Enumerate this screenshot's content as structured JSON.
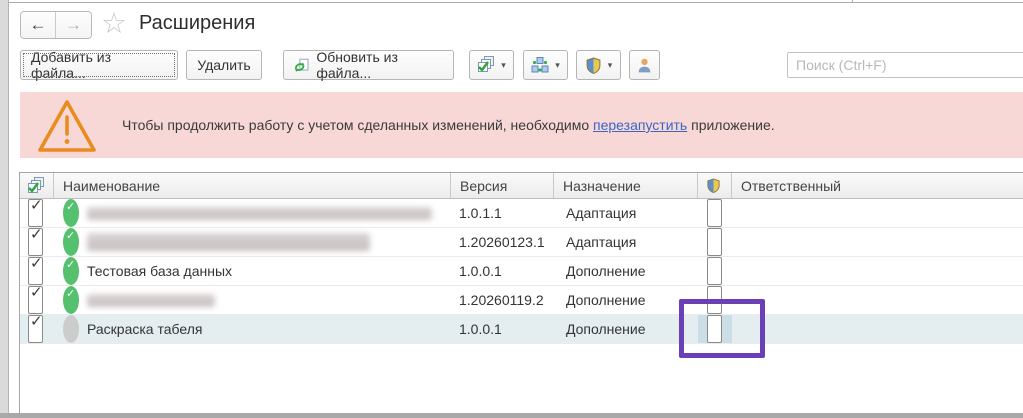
{
  "page": {
    "title": "Расширения"
  },
  "glyphs": {
    "back": "←",
    "forward": "→",
    "favorite_star": "☆",
    "caret": "▾",
    "check": "✓"
  },
  "toolbar": {
    "add_button": "Добавить из файла...",
    "delete_button": "Удалить",
    "update_button": "Обновить из файла...",
    "icon_buttons": [
      {
        "name": "select-actions-button",
        "icon": "stacked-checklist-icon",
        "has_dropdown": true
      },
      {
        "name": "structure-button",
        "icon": "config-blocks-icon",
        "has_dropdown": true
      },
      {
        "name": "safe-mode-button",
        "icon": "shield-icon",
        "has_dropdown": true
      },
      {
        "name": "responsible-button",
        "icon": "person-icon",
        "has_dropdown": false
      }
    ],
    "search": {
      "placeholder": "Поиск (Ctrl+F)"
    }
  },
  "banner": {
    "icon": "warning-triangle-icon",
    "text_before": "Чтобы продолжить работу с учетом сделанных изменений, необходимо ",
    "link_text": "перезапустить",
    "text_after": " приложение.",
    "background_color": "#f8d7d7",
    "triangle_color": "#e78c1e",
    "link_color": "#3a66c4"
  },
  "table": {
    "columns": [
      {
        "key": "select",
        "label": "",
        "icon": "select-all-stacked-checklist-icon"
      },
      {
        "key": "name",
        "label": "Наименование"
      },
      {
        "key": "version",
        "label": "Версия"
      },
      {
        "key": "purpose",
        "label": "Назначение"
      },
      {
        "key": "safe_mode",
        "label": "",
        "icon": "shield-icon"
      },
      {
        "key": "responsible",
        "label": "Ответственный"
      }
    ],
    "rows": [
      {
        "checked": true,
        "status": "active",
        "name": "",
        "redacted": true,
        "version": "1.0.1.1",
        "purpose": "Адаптация",
        "safe_mode_checked": false,
        "responsible": "",
        "selected": false
      },
      {
        "checked": true,
        "status": "active",
        "name": "",
        "redacted": true,
        "version": "1.20260123.1",
        "purpose": "Адаптация",
        "safe_mode_checked": false,
        "responsible": "",
        "selected": false
      },
      {
        "checked": true,
        "status": "active",
        "name": "Тестовая база данных",
        "redacted": false,
        "version": "1.0.0.1",
        "purpose": "Дополнение",
        "safe_mode_checked": false,
        "responsible": "",
        "selected": false
      },
      {
        "checked": true,
        "status": "active",
        "name": "",
        "redacted": true,
        "version": "1.20260119.2",
        "purpose": "Дополнение",
        "safe_mode_checked": false,
        "responsible": "",
        "selected": false
      },
      {
        "checked": true,
        "status": "inactive",
        "name": "Раскраска табеля",
        "redacted": false,
        "version": "1.0.0.1",
        "purpose": "Дополнение",
        "safe_mode_checked": false,
        "responsible": "",
        "selected": true
      }
    ]
  },
  "annotation": {
    "type": "highlight-box",
    "color": "#6b40b6",
    "target": "safe-mode-checkbox-row-5"
  },
  "colors": {
    "selected_row": "#e4eef1",
    "selected_cell": "#cbdee5",
    "status_active": "#55c06e",
    "status_inactive": "#cccccc"
  }
}
